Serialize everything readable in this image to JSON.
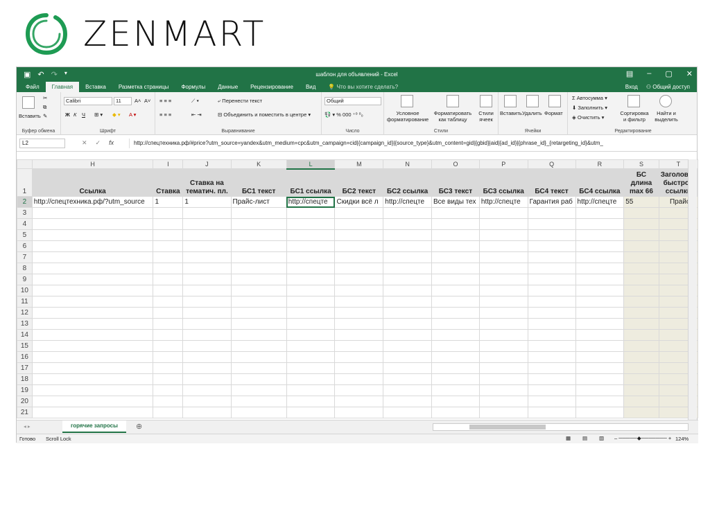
{
  "brand": {
    "name": "ZENMART",
    "ring_color": "#1e9b53"
  },
  "window": {
    "title": "шаблон для объявлений - Excel",
    "accent": "#217346"
  },
  "ribbon": {
    "tabs": [
      "Файл",
      "Главная",
      "Вставка",
      "Разметка страницы",
      "Формулы",
      "Данные",
      "Рецензирование",
      "Вид"
    ],
    "active_tab": "Главная",
    "search_placeholder": "Что вы хотите сделать?",
    "sign_in": "Вход",
    "share": "Общий доступ",
    "clipboard": {
      "paste": "Вставить",
      "label": "Буфер обмена"
    },
    "font": {
      "name": "Calibri",
      "size": "11",
      "label": "Шрифт",
      "bold": "Ж",
      "italic": "К",
      "underline": "Ч"
    },
    "alignment": {
      "wrap": "Перенести текст",
      "merge": "Объединить и поместить в центре",
      "label": "Выравнивание"
    },
    "number": {
      "format": "Общий",
      "label": "Число"
    },
    "styles": {
      "conditional": "Условное форматирование",
      "as_table": "Форматировать как таблицу",
      "cell_styles": "Стили ячеек",
      "label": "Стили"
    },
    "cells": {
      "insert": "Вставить",
      "delete": "Удалить",
      "format": "Формат",
      "label": "Ячейки"
    },
    "editing": {
      "autosum": "Автосумма",
      "fill": "Заполнить",
      "clear": "Очистить",
      "sort": "Сортировка и фильтр",
      "find": "Найти и выделить",
      "label": "Редактирование"
    }
  },
  "formula_bar": {
    "name_box": "L2",
    "formula": "http://спецтехника.рф/#price?utm_source=yandex&utm_medium=cpc&utm_campaign=cid|{campaign_id}|{source_type}&utm_content=gid|{gbid}|aid|{ad_id}|{phrase_id}_{retargeting_id}&utm_"
  },
  "sheet": {
    "columns": [
      "H",
      "I",
      "J",
      "K",
      "L",
      "M",
      "N",
      "O",
      "P",
      "Q",
      "R",
      "S",
      "T"
    ],
    "selected_column": "L",
    "headers": [
      "Ссылка",
      "Ставка",
      "Ставка на тематич. пл.",
      "БС1 текст",
      "БС1 ссылка",
      "БС2 текст",
      "БС2 ссылка",
      "БС3 текст",
      "БС3 ссылка",
      "БС4 текст",
      "БС4 ссылка",
      "БС длина max 66",
      "Заголовок быстрой ссылки"
    ],
    "row2": [
      "http://спецтехника.рф/?utm_source",
      "1",
      "1",
      "Прайс-лист",
      "http://спецте",
      "Скидки всё л",
      "http://спецте",
      "Все виды тех",
      "http://спецте",
      "Гарантия раб",
      "http://спецте",
      "55",
      "Прайс-л"
    ],
    "row_numbers": [
      "1",
      "2",
      "3",
      "4",
      "5",
      "6",
      "7",
      "8",
      "9",
      "10",
      "11",
      "12",
      "13",
      "14",
      "15",
      "16",
      "17",
      "18",
      "19",
      "20",
      "21"
    ],
    "active_tab": "горячие запросы"
  },
  "status": {
    "ready": "Готово",
    "scroll_lock": "Scroll Lock",
    "zoom": "124%"
  }
}
